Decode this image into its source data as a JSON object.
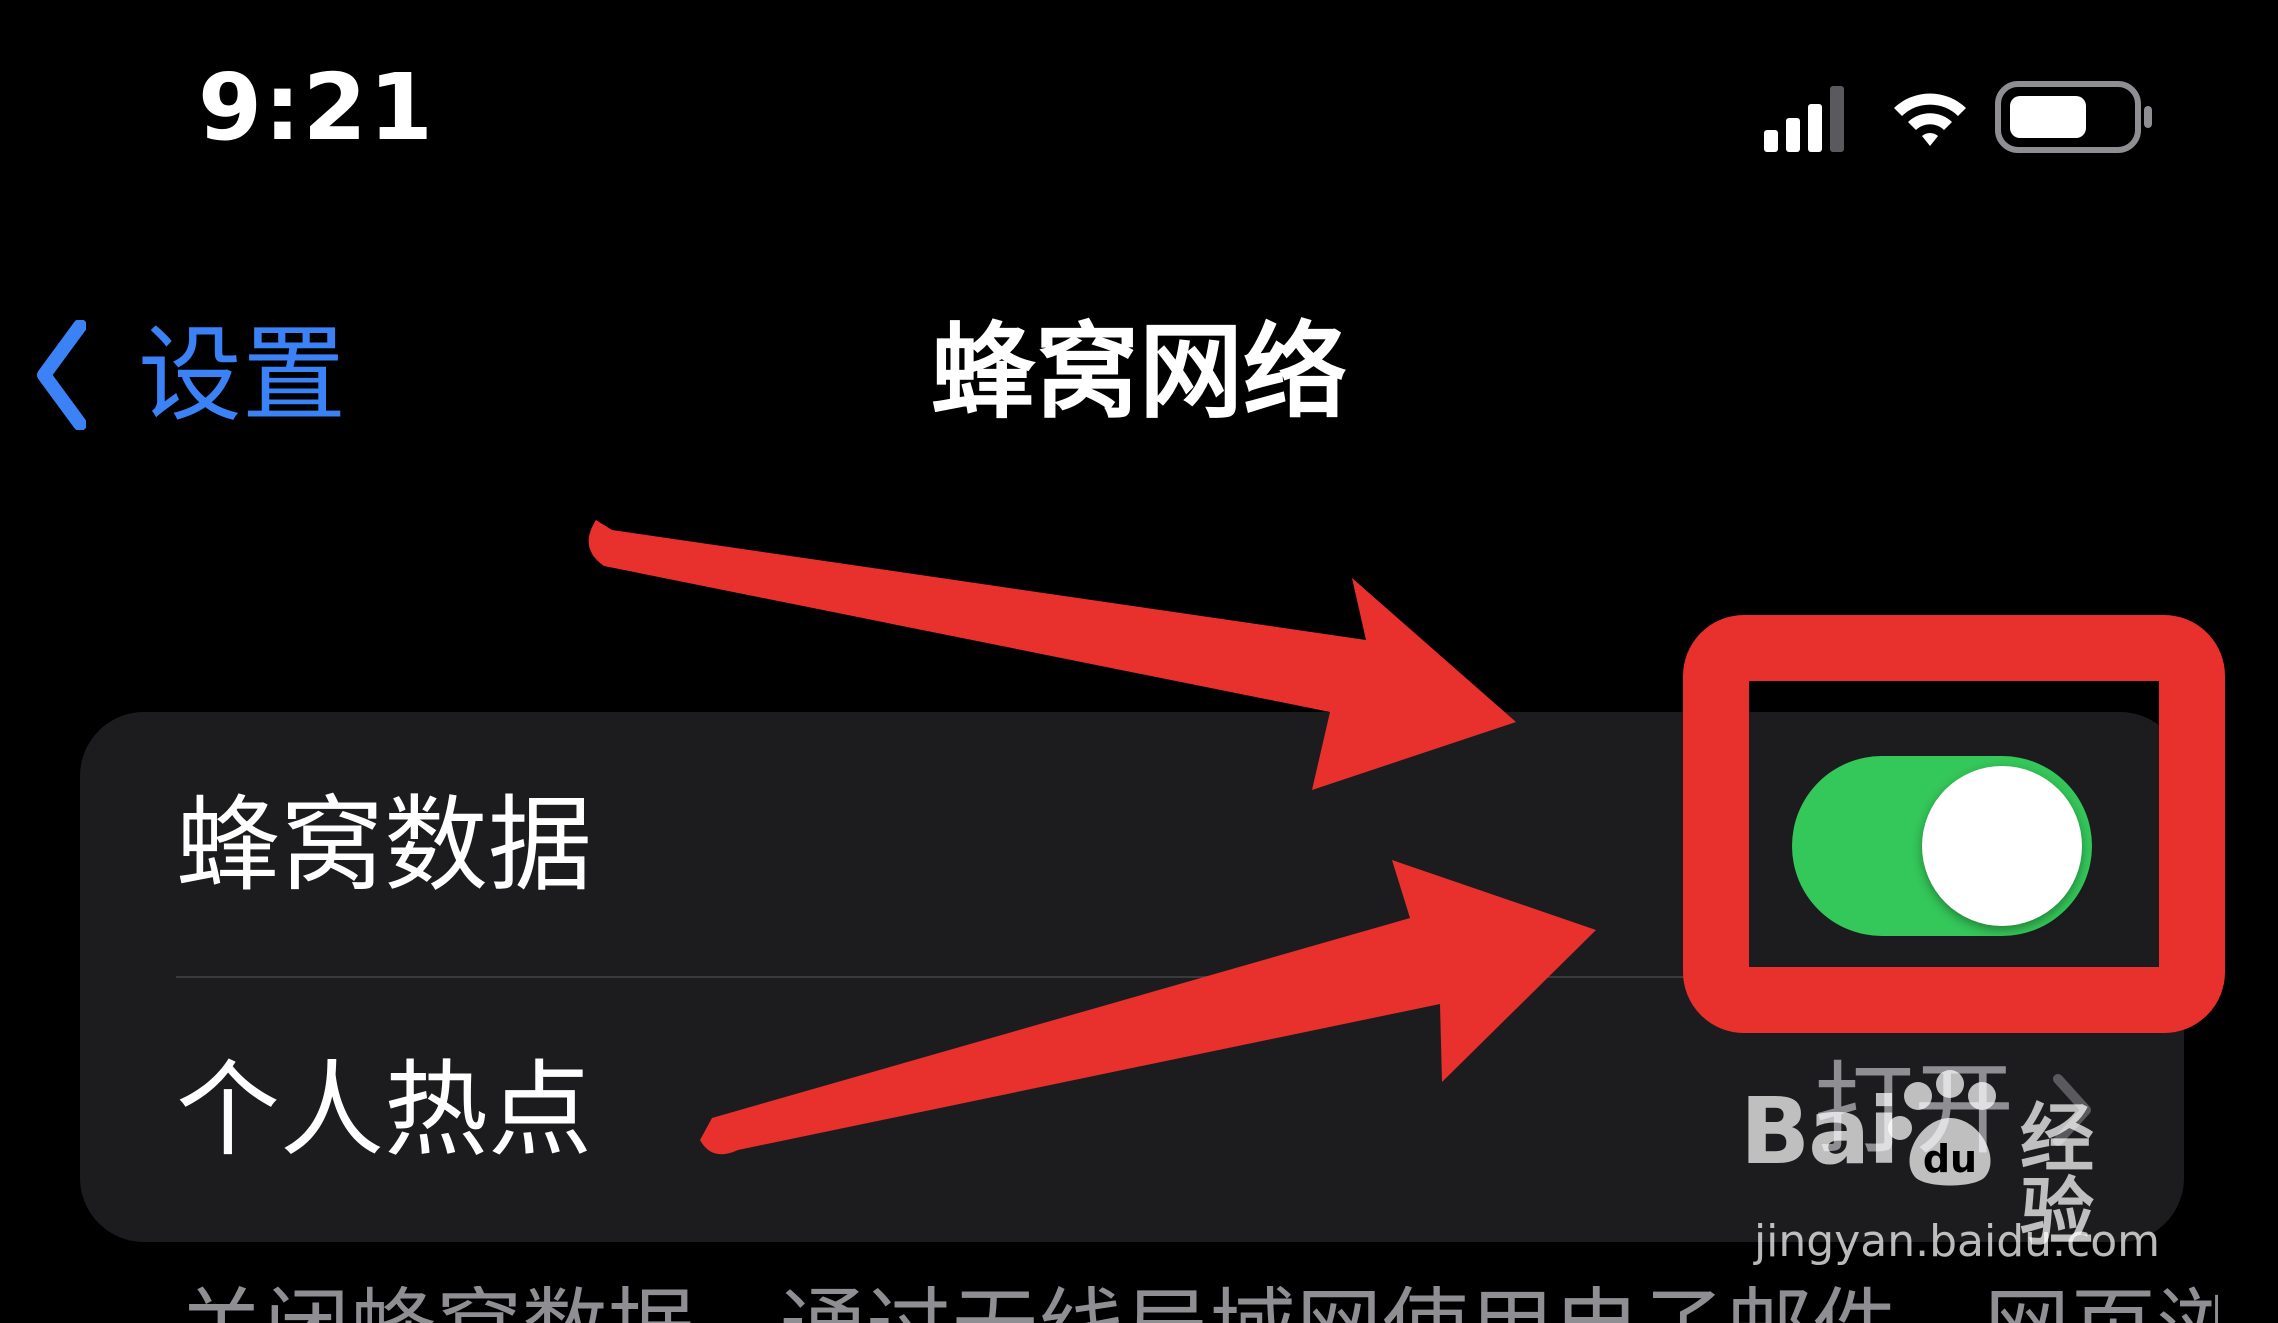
{
  "status_bar": {
    "time": "9:21",
    "icons": [
      "cellular-signal-icon",
      "wifi-icon",
      "battery-icon"
    ]
  },
  "nav": {
    "back_label": "设置",
    "title": "蜂窝网络"
  },
  "group": {
    "rows": [
      {
        "label": "蜂窝数据",
        "control": "toggle",
        "toggle_on": true
      },
      {
        "label": "个人热点",
        "value": "打开",
        "control": "chevron"
      }
    ]
  },
  "footer": {
    "text": "关闭蜂窝数据，通过无线局域网使用电子邮件、网页浏"
  },
  "watermark": {
    "logo_text": "Bai",
    "logo_suffix": "经验",
    "site": "jingyan.baidu.com"
  },
  "colors": {
    "background": "#000000",
    "group_bg": "#1c1c1e",
    "accent_blue": "#3b82f6",
    "toggle_on": "#34c759",
    "secondary_text": "#8e8e93",
    "annotation_red": "#e8302d"
  }
}
